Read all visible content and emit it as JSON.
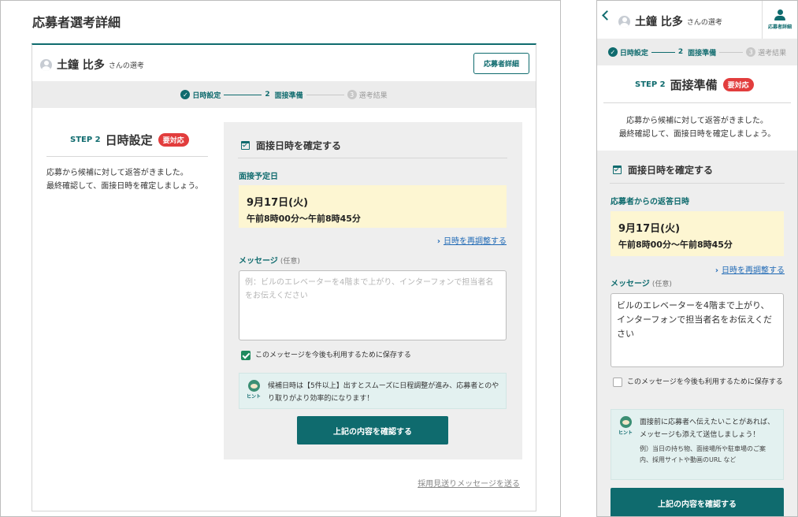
{
  "desktop": {
    "page_title": "応募者選考詳細",
    "candidate_name": "土鐘 比多",
    "candidate_suffix": "さんの選考",
    "detail_button": "応募者詳細",
    "steps": [
      {
        "num": "1",
        "label": "日時設定",
        "state": "done"
      },
      {
        "num": "2",
        "label": "面接準備",
        "state": "current"
      },
      {
        "num": "3",
        "label": "選考結果",
        "state": "upcoming"
      }
    ],
    "step_label": "STEP 2",
    "step_title": "日時設定",
    "badge": "要対応",
    "instruction_line1": "応募から候補に対して返答がきました。",
    "instruction_line2": "最終確認して、面接日時を確定しましょう。",
    "panel_title": "面接日時を確定する",
    "date_label": "面接予定日",
    "date_main": "9月17日(火)",
    "date_time": "午前8時00分〜午前8時45分",
    "reschedule_link": "日時を再調整する",
    "message_label": "メッセージ",
    "message_optional": "(任意)",
    "message_placeholder": "例：ビルのエレベーターを4階まで上がり、インターフォンで担当者名をお伝えください",
    "save_checkbox_label": "このメッセージを今後も利用するために保存する",
    "save_checked": true,
    "hint_icon_text": "ヒント",
    "hint_text": "候補日時は【5件以上】出すとスムーズに日程調整が進み、応募者とのやり取りがより効率的になります！",
    "confirm_button": "上記の内容を確認する",
    "reject_link": "採用見送りメッセージを送る"
  },
  "mobile": {
    "candidate_name": "土鐘 比多",
    "candidate_suffix": "さんの選考",
    "user_button_label": "応募者詳細",
    "steps": [
      {
        "num": "1",
        "label": "日時設定",
        "state": "done"
      },
      {
        "num": "2",
        "label": "面接準備",
        "state": "current"
      },
      {
        "num": "3",
        "label": "選考結果",
        "state": "upcoming"
      }
    ],
    "step_label": "STEP 2",
    "step_title": "面接準備",
    "badge": "要対応",
    "instruction_line1": "応募から候補に対して返答がきました。",
    "instruction_line2": "最終確認して、面接日時を確定しましょう。",
    "panel_title": "面接日時を確定する",
    "date_label": "応募者からの返答日時",
    "date_main": "9月17日(火)",
    "date_time": "午前8時00分〜午前8時45分",
    "reschedule_link": "日時を再調整する",
    "message_label": "メッセージ",
    "message_optional": "(任意)",
    "message_value": "ビルのエレベーターを4階まで上がり、インターフォンで担当者名をお伝えください",
    "save_checkbox_label": "このメッセージを今後も利用するために保存する",
    "save_checked": false,
    "hint_icon_text": "ヒント",
    "hint_text": "面接前に応募者へ伝えたいことがあれば、メッセージも添えて送信しましょう！",
    "hint_example": "例）当日の持ち物、面接場所や駐車場のご案内、採用サイトや動画のURL など",
    "confirm_button": "上記の内容を確認する"
  },
  "colors": {
    "accent": "#0f6b6e",
    "badge": "#e23d3d",
    "date_bg": "#fdf6d2",
    "hint_bg": "#e3f1f0",
    "panel_bg": "#eeeeee",
    "link": "#1f69b5"
  }
}
